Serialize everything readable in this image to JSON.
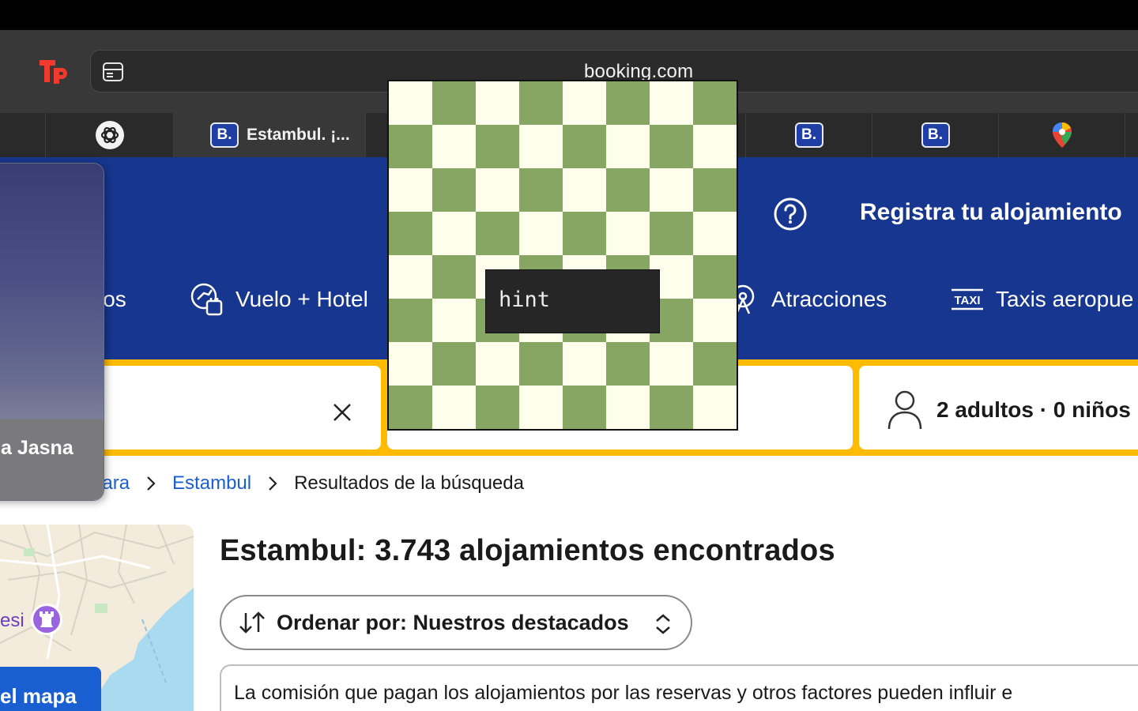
{
  "browser": {
    "url": "booking.com",
    "tabs": [
      {
        "favicon": "openai-icon",
        "title": ""
      },
      {
        "favicon": "booking-icon",
        "title": "Estambul. ¡..."
      },
      {
        "favicon": "booking-icon",
        "title": ""
      },
      {
        "favicon": "booking-icon",
        "title": ""
      },
      {
        "favicon": "google-maps-icon",
        "title": ""
      }
    ]
  },
  "header": {
    "register_label": "Registra tu alojamiento",
    "nav": {
      "stays_partial": "los",
      "flight_hotel": "Vuelo + Hotel",
      "attractions": "Atracciones",
      "taxis": "Taxis aeropue"
    }
  },
  "search": {
    "guests": "2 adultos · 0 niños ·"
  },
  "breadcrumb": {
    "prev_partial": "nara",
    "city": "Estambul",
    "current": "Resultados de la búsqueda"
  },
  "map": {
    "label_partial": "esi",
    "button_partial": "el mapa"
  },
  "results": {
    "title": "Estambul: 3.743 alojamientos encontrados",
    "sort_label": "Ordenar por: Nuestros destacados",
    "notice": "La comisión que pagan los alojamientos por las reservas y otros factores pueden influir e"
  },
  "floating_card": {
    "caption": "a Jasna"
  },
  "overlay": {
    "hint_text": "hint"
  },
  "colors": {
    "booking_blue": "#17368f",
    "search_yellow": "#febb02",
    "link_blue": "#1a5fd1",
    "board_light": "#fdffec",
    "board_dark": "#88a663"
  }
}
